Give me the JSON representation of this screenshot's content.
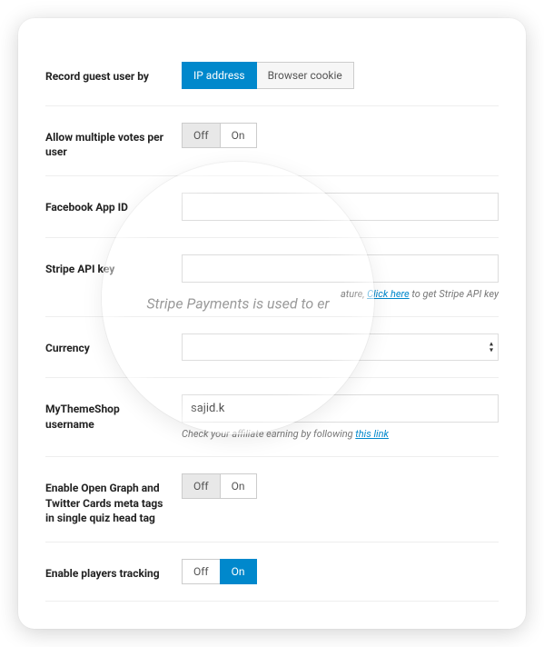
{
  "rows": {
    "record_guest": {
      "label": "Record guest user by",
      "opt_a": "IP address",
      "opt_b": "Browser cookie"
    },
    "multi_vote": {
      "label": "Allow multiple votes per user",
      "opt_off": "Off",
      "opt_on": "On"
    },
    "fb_app": {
      "label": "Facebook App ID",
      "value": ""
    },
    "stripe_key": {
      "label": "Stripe API key",
      "value": "",
      "help_prefix": "ature, ",
      "help_link": "Click here",
      "help_suffix": " to get Stripe API key"
    },
    "currency": {
      "label": "Currency",
      "value": ""
    },
    "mts_user": {
      "label": "MyThemeShop username",
      "value": "sajid.k",
      "help_prefix": "Check your affiliate earning by following ",
      "help_link": "this link"
    },
    "open_graph": {
      "label": "Enable Open Graph and Twitter Cards meta tags in single quiz head tag",
      "opt_off": "Off",
      "opt_on": "On"
    },
    "tracking": {
      "label": "Enable players tracking",
      "opt_off": "Off",
      "opt_on": "On"
    }
  },
  "lens_caption": "Stripe Payments is used to er"
}
